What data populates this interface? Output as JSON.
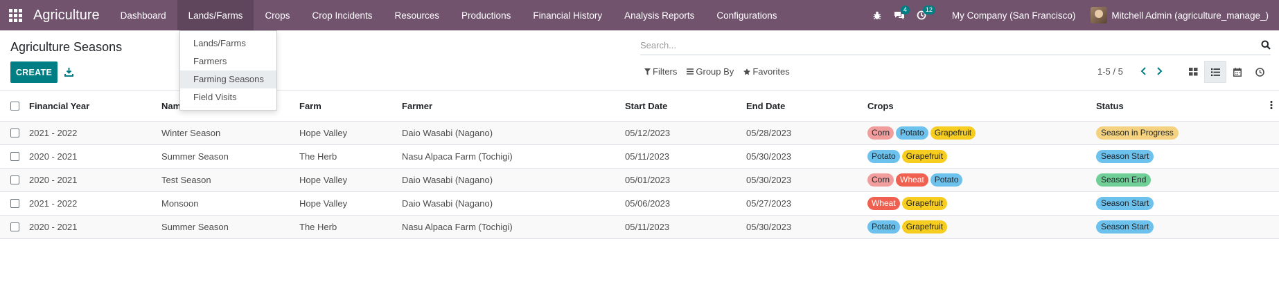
{
  "navbar": {
    "brand": "Agriculture",
    "menu": [
      {
        "label": "Dashboard",
        "active": false
      },
      {
        "label": "Lands/Farms",
        "active": true
      },
      {
        "label": "Crops",
        "active": false
      },
      {
        "label": "Crop Incidents",
        "active": false
      },
      {
        "label": "Resources",
        "active": false
      },
      {
        "label": "Productions",
        "active": false
      },
      {
        "label": "Financial History",
        "active": false
      },
      {
        "label": "Analysis Reports",
        "active": false
      },
      {
        "label": "Configurations",
        "active": false
      }
    ],
    "messages_badge": "4",
    "activities_badge": "12",
    "company": "My Company (San Francisco)",
    "user": "Mitchell Admin (agriculture_manage_)"
  },
  "dropdown": {
    "items": [
      "Lands/Farms",
      "Farmers",
      "Farming Seasons",
      "Field Visits"
    ],
    "hover_index": 2
  },
  "control_panel": {
    "title": "Agriculture Seasons",
    "create_label": "CREATE",
    "search_placeholder": "Search...",
    "filters_label": "Filters",
    "group_by_label": "Group By",
    "favorites_label": "Favorites",
    "pager": "1-5 / 5"
  },
  "table": {
    "headers": [
      "Financial Year",
      "Name",
      "Farm",
      "Farmer",
      "Start Date",
      "End Date",
      "Crops",
      "Status"
    ],
    "rows": [
      {
        "year": "2021 - 2022",
        "name": "Winter Season",
        "farm": "Hope Valley",
        "farmer": "Daio Wasabi (Nagano)",
        "start": "05/12/2023",
        "end": "05/28/2023",
        "crops": [
          "Corn",
          "Potato",
          "Grapefruit"
        ],
        "status": "Season in Progress"
      },
      {
        "year": "2020 - 2021",
        "name": "Summer Season",
        "farm": "The Herb",
        "farmer": "Nasu Alpaca Farm (Tochigi)",
        "start": "05/11/2023",
        "end": "05/30/2023",
        "crops": [
          "Potato",
          "Grapefruit"
        ],
        "status": "Season Start"
      },
      {
        "year": "2020 - 2021",
        "name": "Test Season",
        "farm": "Hope Valley",
        "farmer": "Daio Wasabi (Nagano)",
        "start": "05/01/2023",
        "end": "05/30/2023",
        "crops": [
          "Corn",
          "Wheat",
          "Potato"
        ],
        "status": "Season End"
      },
      {
        "year": "2021 - 2022",
        "name": "Monsoon",
        "farm": "Hope Valley",
        "farmer": "Daio Wasabi (Nagano)",
        "start": "05/06/2023",
        "end": "05/27/2023",
        "crops": [
          "Wheat",
          "Grapefruit"
        ],
        "status": "Season Start"
      },
      {
        "year": "2020 - 2021",
        "name": "Summer Season",
        "farm": "The Herb",
        "farmer": "Nasu Alpaca Farm (Tochigi)",
        "start": "05/11/2023",
        "end": "05/30/2023",
        "crops": [
          "Potato",
          "Grapefruit"
        ],
        "status": "Season Start"
      }
    ]
  },
  "colors": {
    "navbar": "#71536e",
    "primary": "#017e84",
    "Corn": "#f29d9d",
    "Potato": "#6cc1ed",
    "Grapefruit": "#f7cd1f",
    "Wheat": "#f06050",
    "Season in Progress": "#f4d27f",
    "Season Start": "#6cc1ed",
    "Season End": "#6fcf97"
  }
}
